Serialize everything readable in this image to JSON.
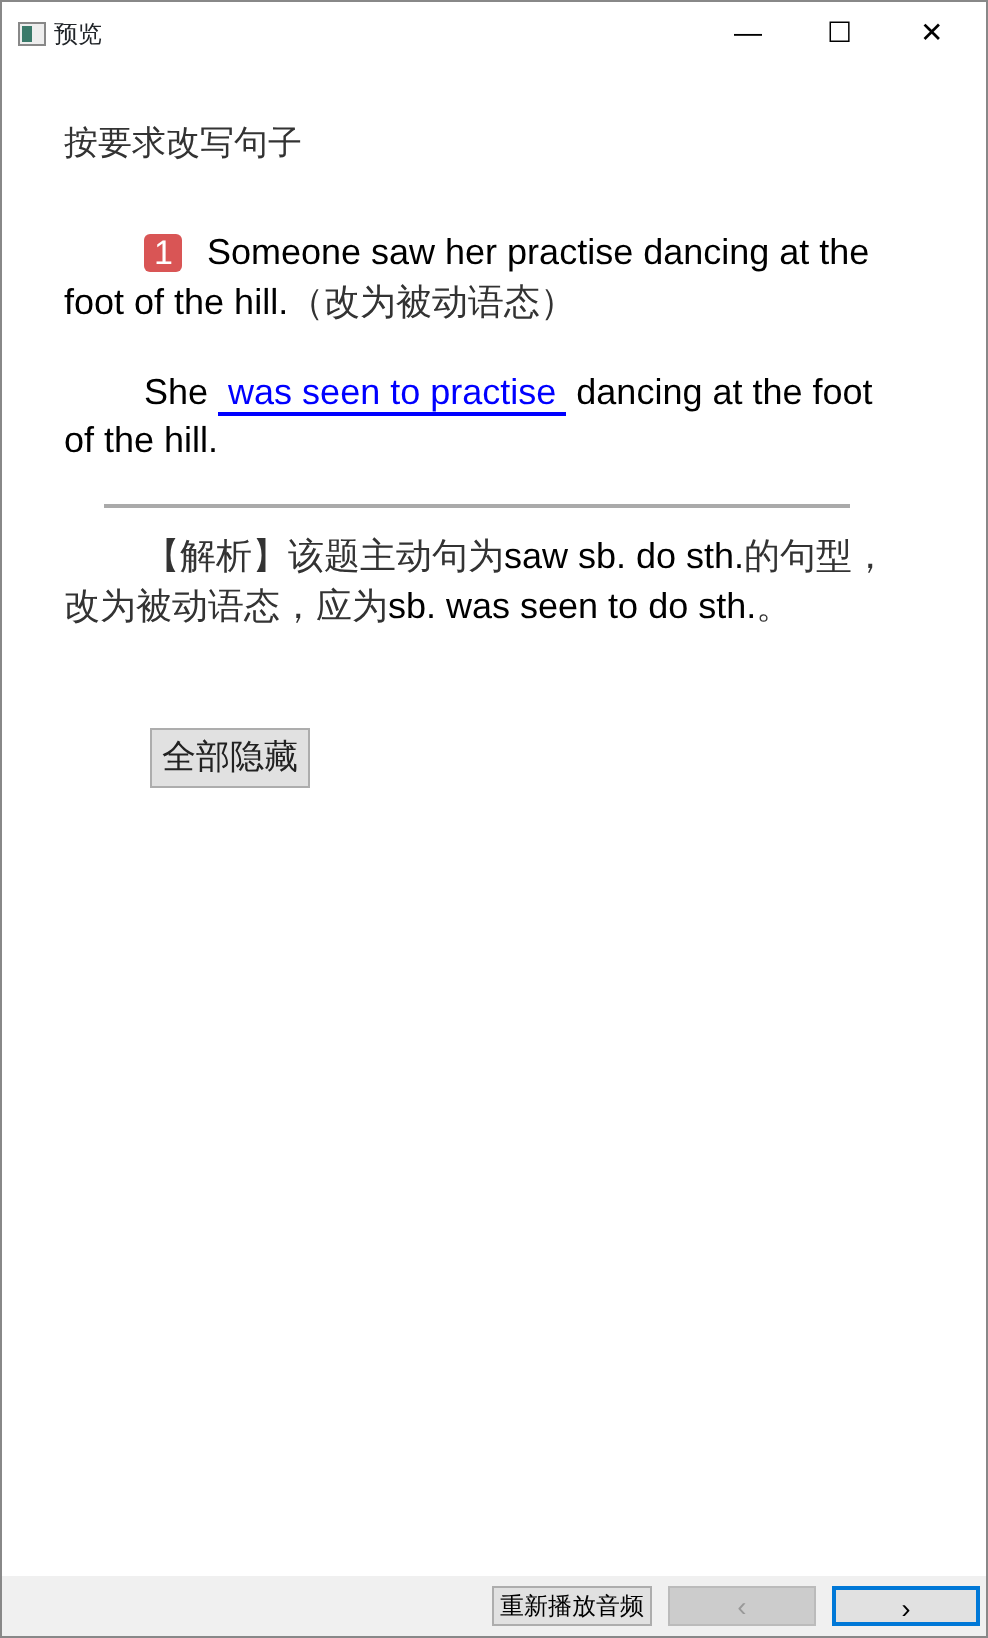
{
  "window": {
    "title": "预览",
    "controls": [
      "—",
      "☐",
      "✕"
    ]
  },
  "heading": "按要求改写句子",
  "question": {
    "number": "1",
    "text": "Someone saw her practise dancing at the foot of the hill.",
    "note": "（改为被动语态）"
  },
  "answer": {
    "before": "She",
    "blank": "was seen to practise",
    "after": "dancing at the foot of the hill."
  },
  "analysis": {
    "label": "【解析】",
    "parts": [
      {
        "kind": "cn",
        "text": "该题主动句为"
      },
      {
        "kind": "en",
        "text": "saw sb. do sth."
      },
      {
        "kind": "cn",
        "text": "的句型，改为被动语态，应为"
      },
      {
        "kind": "en",
        "text": "sb. was seen to do sth."
      },
      {
        "kind": "cn",
        "text": "。"
      }
    ]
  },
  "hide_button": "全部隐藏",
  "footer": {
    "replay": "重新播放音频",
    "prev": {
      "label": "‹",
      "disabled": true
    },
    "next": {
      "label": "›",
      "disabled": false
    }
  }
}
